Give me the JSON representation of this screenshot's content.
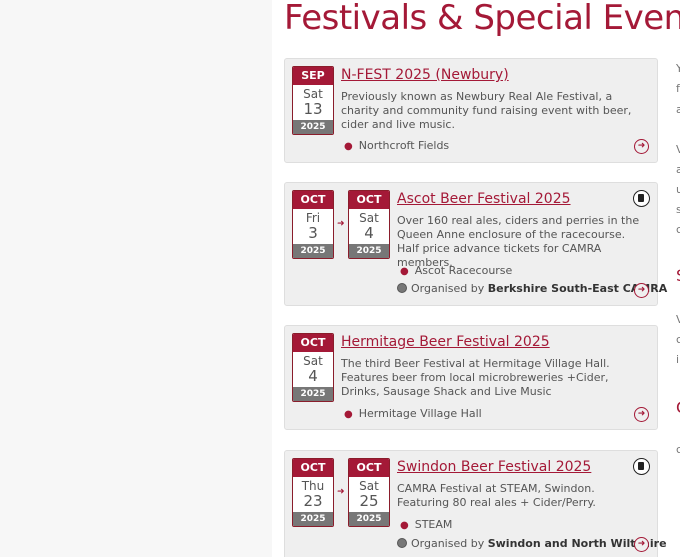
{
  "page": {
    "title": "Festivals & Special Events"
  },
  "events": [
    {
      "month": "SEP",
      "dow": "Sat",
      "day": "13",
      "year": "2025",
      "title": "N-FEST 2025 (Newbury)",
      "description": "Previously known as Newbury Real Ale Festival, a charity and community fund raising event with beer, cider and live music.",
      "location": "Northcroft Fields"
    },
    {
      "start": {
        "month": "OCT",
        "dow": "Fri",
        "day": "3",
        "year": "2025"
      },
      "end": {
        "month": "OCT",
        "dow": "Sat",
        "day": "4",
        "year": "2025"
      },
      "title": "Ascot Beer Festival 2025",
      "description": "Over 160 real ales, ciders and perries in the Queen Anne enclosure of the racecourse. Half price advance tickets for CAMRA members.",
      "location": "Ascot Racecourse",
      "organised_prefix": "Organised by",
      "organiser": "Berkshire South-East CAMRA"
    },
    {
      "month": "OCT",
      "dow": "Sat",
      "day": "4",
      "year": "2025",
      "title": "Hermitage Beer Festival 2025",
      "description": "The third Beer Festival at Hermitage Village Hall. Features beer from local microbreweries +Cider, Drinks, Sausage Shack and Live Music",
      "location": "Hermitage Village Hall"
    },
    {
      "start": {
        "month": "OCT",
        "dow": "Thu",
        "day": "23",
        "year": "2025"
      },
      "end": {
        "month": "OCT",
        "dow": "Sat",
        "day": "25",
        "year": "2025"
      },
      "title": "Swindon Beer Festival 2025",
      "description": "CAMRA Festival at STEAM, Swindon. Featuring 80 real ales + Cider/Perry.",
      "location": "STEAM",
      "organised_prefix": "Organised by",
      "organiser": "Swindon and North Wiltshire"
    }
  ],
  "right_column": [
    "Y",
    "f",
    "a",
    "V",
    "a",
    "u",
    "s",
    "c",
    "S",
    "V",
    "c",
    "i",
    "C",
    "c"
  ],
  "icons": {
    "location": "map-pin-icon",
    "more": "arrow-right-circle-icon",
    "camra": "beer-mug-icon",
    "range": "arrow-right-icon"
  },
  "colors": {
    "accent": "#a41937",
    "year_band": "#777777",
    "card_bg": "#efefef"
  }
}
